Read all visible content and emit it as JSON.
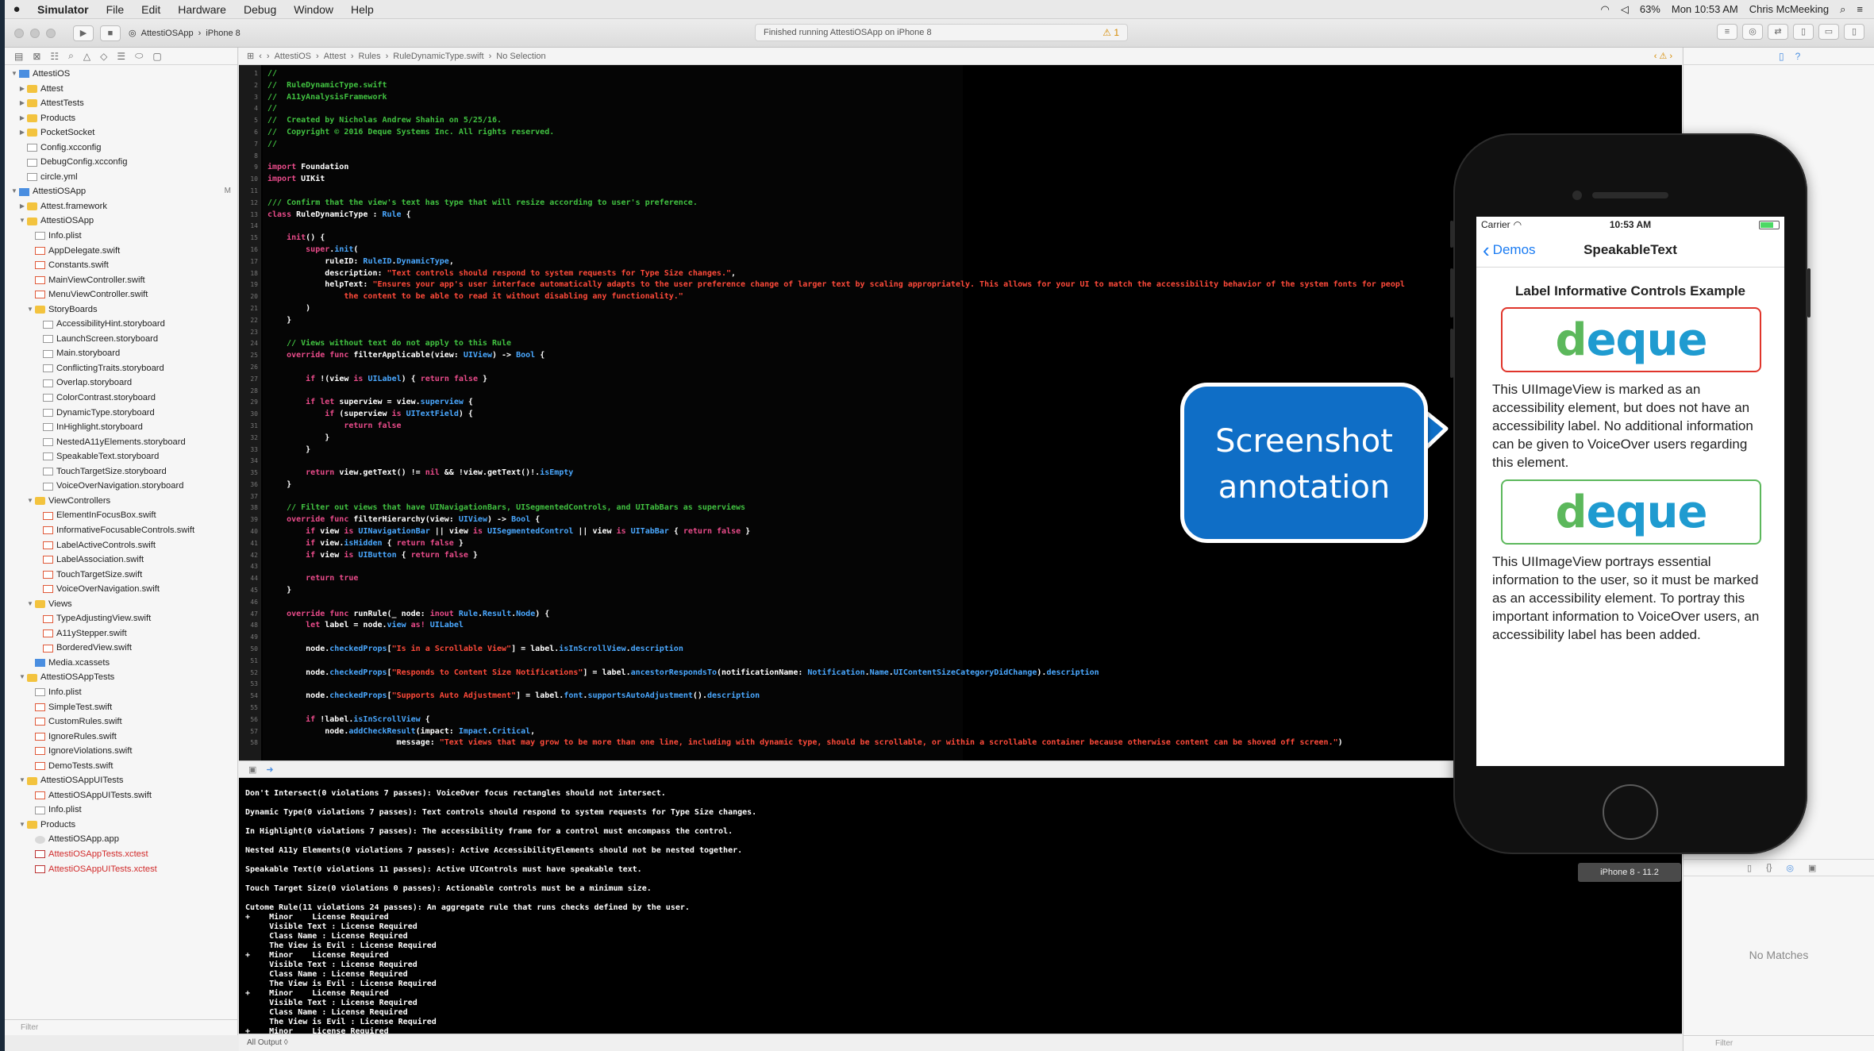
{
  "menubar": {
    "apple": "",
    "items": [
      "Simulator",
      "File",
      "Edit",
      "Hardware",
      "Debug",
      "Window",
      "Help"
    ],
    "battery": "63%",
    "clock": "Mon 10:53 AM",
    "user": "Chris McMeeking"
  },
  "toolbar": {
    "scheme": "AttestiOSApp",
    "device": "iPhone 8",
    "activity": "Finished running AttestiOSApp on iPhone 8",
    "warning_count": "1"
  },
  "jumpbar": [
    "AttestiOS",
    "Attest",
    "Rules",
    "RuleDynamicType.swift",
    "No Selection"
  ],
  "navigator": {
    "filter_placeholder": "Filter",
    "rows": [
      {
        "t": "AttestiOS",
        "d": 0,
        "tri": "▼",
        "i": "proj"
      },
      {
        "t": "Attest",
        "d": 1,
        "tri": "▶",
        "i": "folder"
      },
      {
        "t": "AttestTests",
        "d": 1,
        "tri": "▶",
        "i": "folder"
      },
      {
        "t": "Products",
        "d": 1,
        "tri": "▶",
        "i": "folder"
      },
      {
        "t": "PocketSocket",
        "d": 1,
        "tri": "▶",
        "i": "folder"
      },
      {
        "t": "Config.xcconfig",
        "d": 1,
        "tri": "",
        "i": "file"
      },
      {
        "t": "DebugConfig.xcconfig",
        "d": 1,
        "tri": "",
        "i": "file"
      },
      {
        "t": "circle.yml",
        "d": 1,
        "tri": "",
        "i": "file"
      },
      {
        "t": "AttestiOSApp",
        "d": 0,
        "tri": "▼",
        "i": "proj",
        "badge": "M"
      },
      {
        "t": "Attest.framework",
        "d": 1,
        "tri": "▶",
        "i": "folder"
      },
      {
        "t": "AttestiOSApp",
        "d": 1,
        "tri": "▼",
        "i": "folder"
      },
      {
        "t": "Info.plist",
        "d": 2,
        "tri": "",
        "i": "file"
      },
      {
        "t": "AppDelegate.swift",
        "d": 2,
        "tri": "",
        "i": "swift"
      },
      {
        "t": "Constants.swift",
        "d": 2,
        "tri": "",
        "i": "swift"
      },
      {
        "t": "MainViewController.swift",
        "d": 2,
        "tri": "",
        "i": "swift"
      },
      {
        "t": "MenuViewController.swift",
        "d": 2,
        "tri": "",
        "i": "swift"
      },
      {
        "t": "StoryBoards",
        "d": 2,
        "tri": "▼",
        "i": "folder"
      },
      {
        "t": "AccessibilityHint.storyboard",
        "d": 3,
        "tri": "",
        "i": "file"
      },
      {
        "t": "LaunchScreen.storyboard",
        "d": 3,
        "tri": "",
        "i": "file"
      },
      {
        "t": "Main.storyboard",
        "d": 3,
        "tri": "",
        "i": "file"
      },
      {
        "t": "ConflictingTraits.storyboard",
        "d": 3,
        "tri": "",
        "i": "file"
      },
      {
        "t": "Overlap.storyboard",
        "d": 3,
        "tri": "",
        "i": "file"
      },
      {
        "t": "ColorContrast.storyboard",
        "d": 3,
        "tri": "",
        "i": "file"
      },
      {
        "t": "DynamicType.storyboard",
        "d": 3,
        "tri": "",
        "i": "file"
      },
      {
        "t": "InHighlight.storyboard",
        "d": 3,
        "tri": "",
        "i": "file"
      },
      {
        "t": "NestedA11yElements.storyboard",
        "d": 3,
        "tri": "",
        "i": "file"
      },
      {
        "t": "SpeakableText.storyboard",
        "d": 3,
        "tri": "",
        "i": "file"
      },
      {
        "t": "TouchTargetSize.storyboard",
        "d": 3,
        "tri": "",
        "i": "file"
      },
      {
        "t": "VoiceOverNavigation.storyboard",
        "d": 3,
        "tri": "",
        "i": "file"
      },
      {
        "t": "ViewControllers",
        "d": 2,
        "tri": "▼",
        "i": "folder"
      },
      {
        "t": "ElementInFocusBox.swift",
        "d": 3,
        "tri": "",
        "i": "swift"
      },
      {
        "t": "InformativeFocusableControls.swift",
        "d": 3,
        "tri": "",
        "i": "swift"
      },
      {
        "t": "LabelActiveControls.swift",
        "d": 3,
        "tri": "",
        "i": "swift"
      },
      {
        "t": "LabelAssociation.swift",
        "d": 3,
        "tri": "",
        "i": "swift"
      },
      {
        "t": "TouchTargetSize.swift",
        "d": 3,
        "tri": "",
        "i": "swift"
      },
      {
        "t": "VoiceOverNavigation.swift",
        "d": 3,
        "tri": "",
        "i": "swift"
      },
      {
        "t": "Views",
        "d": 2,
        "tri": "▼",
        "i": "folder"
      },
      {
        "t": "TypeAdjustingView.swift",
        "d": 3,
        "tri": "",
        "i": "swift"
      },
      {
        "t": "A11yStepper.swift",
        "d": 3,
        "tri": "",
        "i": "swift"
      },
      {
        "t": "BorderedView.swift",
        "d": 3,
        "tri": "",
        "i": "swift"
      },
      {
        "t": "Media.xcassets",
        "d": 2,
        "tri": "",
        "i": "proj"
      },
      {
        "t": "AttestiOSAppTests",
        "d": 1,
        "tri": "▼",
        "i": "folder"
      },
      {
        "t": "Info.plist",
        "d": 2,
        "tri": "",
        "i": "file"
      },
      {
        "t": "SimpleTest.swift",
        "d": 2,
        "tri": "",
        "i": "swift"
      },
      {
        "t": "CustomRules.swift",
        "d": 2,
        "tri": "",
        "i": "swift"
      },
      {
        "t": "IgnoreRules.swift",
        "d": 2,
        "tri": "",
        "i": "swift"
      },
      {
        "t": "IgnoreViolations.swift",
        "d": 2,
        "tri": "",
        "i": "swift"
      },
      {
        "t": "DemoTests.swift",
        "d": 2,
        "tri": "",
        "i": "swift"
      },
      {
        "t": "AttestiOSAppUITests",
        "d": 1,
        "tri": "▼",
        "i": "folder"
      },
      {
        "t": "AttestiOSAppUITests.swift",
        "d": 2,
        "tri": "",
        "i": "swift"
      },
      {
        "t": "Info.plist",
        "d": 2,
        "tri": "",
        "i": "file"
      },
      {
        "t": "Products",
        "d": 1,
        "tri": "▼",
        "i": "folder"
      },
      {
        "t": "AttestiOSApp.app",
        "d": 2,
        "tri": "",
        "i": "app"
      },
      {
        "t": "AttestiOSAppTests.xctest",
        "d": 2,
        "tri": "",
        "i": "xc",
        "red": true
      },
      {
        "t": "AttestiOSAppUITests.xctest",
        "d": 2,
        "tri": "",
        "i": "xc",
        "red": true
      }
    ]
  },
  "code_lines": [
    [
      [
        "//",
        "com"
      ]
    ],
    [
      [
        "//  RuleDynamicType.swift",
        "com"
      ]
    ],
    [
      [
        "//  A11yAnalysisFramework",
        "com"
      ]
    ],
    [
      [
        "//",
        "com"
      ]
    ],
    [
      [
        "//  Created by Nicholas Andrew Shahin on 5/25/16.",
        "com"
      ]
    ],
    [
      [
        "//  Copyright © 2016 Deque Systems Inc. All rights reserved.",
        "com"
      ]
    ],
    [
      [
        "//",
        "com"
      ]
    ],
    [],
    [
      [
        "import",
        "kw"
      ],
      [
        " Foundation",
        ""
      ]
    ],
    [
      [
        "import",
        "kw"
      ],
      [
        " UIKit",
        ""
      ]
    ],
    [],
    [
      [
        "/// Confirm that the view's text has type that will resize according to user's preference.",
        "com"
      ]
    ],
    [
      [
        "class",
        "kw"
      ],
      [
        " RuleDynamicType : ",
        ""
      ],
      [
        "Rule",
        "ty"
      ],
      [
        " {",
        ""
      ]
    ],
    [],
    [
      [
        "    init",
        "kw"
      ],
      [
        "() {",
        ""
      ]
    ],
    [
      [
        "        super",
        "kw"
      ],
      [
        ".",
        ""
      ],
      [
        "init",
        "fn"
      ],
      [
        "(",
        ""
      ]
    ],
    [
      [
        "            ruleID: ",
        ""
      ],
      [
        "RuleID",
        "ty"
      ],
      [
        ".",
        ""
      ],
      [
        "DynamicType",
        "ty"
      ],
      [
        ",",
        ""
      ]
    ],
    [
      [
        "            description: ",
        ""
      ],
      [
        "\"Text controls should respond to system requests for Type Size changes.\"",
        "str"
      ],
      [
        ",",
        ""
      ]
    ],
    [
      [
        "            helpText: ",
        ""
      ],
      [
        "\"Ensures your app's user interface automatically adapts to the user preference change of larger text by scaling appropriately. This allows for your UI to match the accessibility behavior of the system fonts for peopl",
        "str"
      ]
    ],
    [
      [
        "                the content to be able to read it without disabling any functionality.\"",
        "str"
      ]
    ],
    [
      [
        "        )",
        ""
      ]
    ],
    [
      [
        "    }",
        ""
      ]
    ],
    [],
    [
      [
        "    // Views without text do not apply to this Rule",
        "com"
      ]
    ],
    [
      [
        "    override func",
        "kw"
      ],
      [
        " filterApplicable(view: ",
        ""
      ],
      [
        "UIView",
        "ty"
      ],
      [
        ") -> ",
        ""
      ],
      [
        "Bool",
        "ty"
      ],
      [
        " {",
        ""
      ]
    ],
    [],
    [
      [
        "        if",
        "kw"
      ],
      [
        " !(view ",
        ""
      ],
      [
        "is",
        "kw"
      ],
      [
        " ",
        ""
      ],
      [
        "UILabel",
        "ty"
      ],
      [
        ") { ",
        ""
      ],
      [
        "return false",
        "kw"
      ],
      [
        " }",
        ""
      ]
    ],
    [],
    [
      [
        "        if let",
        "kw"
      ],
      [
        " superview = view.",
        ""
      ],
      [
        "superview",
        "fn"
      ],
      [
        " {",
        ""
      ]
    ],
    [
      [
        "            if",
        "kw"
      ],
      [
        " (superview ",
        ""
      ],
      [
        "is",
        "kw"
      ],
      [
        " ",
        ""
      ],
      [
        "UITextField",
        "ty"
      ],
      [
        ") {",
        ""
      ]
    ],
    [
      [
        "                return false",
        "kw"
      ]
    ],
    [
      [
        "            }",
        ""
      ]
    ],
    [
      [
        "        }",
        ""
      ]
    ],
    [],
    [
      [
        "        return",
        "kw"
      ],
      [
        " view.getText() != ",
        ""
      ],
      [
        "nil",
        "kw"
      ],
      [
        " && !view.getText()!.",
        ""
      ],
      [
        "isEmpty",
        "fn"
      ]
    ],
    [
      [
        "    }",
        ""
      ]
    ],
    [],
    [
      [
        "    // Filter out views that have UINavigationBars, UISegmentedControls, and UITabBars as superviews",
        "com"
      ]
    ],
    [
      [
        "    override func",
        "kw"
      ],
      [
        " filterHierarchy(view: ",
        ""
      ],
      [
        "UIView",
        "ty"
      ],
      [
        ") -> ",
        ""
      ],
      [
        "Bool",
        "ty"
      ],
      [
        " {",
        ""
      ]
    ],
    [
      [
        "        if",
        "kw"
      ],
      [
        " view ",
        ""
      ],
      [
        "is",
        "kw"
      ],
      [
        " ",
        ""
      ],
      [
        "UINavigationBar",
        "ty"
      ],
      [
        " || view ",
        ""
      ],
      [
        "is",
        "kw"
      ],
      [
        " ",
        ""
      ],
      [
        "UISegmentedControl",
        "ty"
      ],
      [
        " || view ",
        ""
      ],
      [
        "is",
        "kw"
      ],
      [
        " ",
        ""
      ],
      [
        "UITabBar",
        "ty"
      ],
      [
        " { ",
        ""
      ],
      [
        "return false",
        "kw"
      ],
      [
        " }",
        ""
      ]
    ],
    [
      [
        "        if",
        "kw"
      ],
      [
        " view.",
        ""
      ],
      [
        "isHidden",
        "fn"
      ],
      [
        " { ",
        ""
      ],
      [
        "return false",
        "kw"
      ],
      [
        " }",
        ""
      ]
    ],
    [
      [
        "        if",
        "kw"
      ],
      [
        " view ",
        ""
      ],
      [
        "is",
        "kw"
      ],
      [
        " ",
        ""
      ],
      [
        "UIButton",
        "ty"
      ],
      [
        " { ",
        ""
      ],
      [
        "return false",
        "kw"
      ],
      [
        " }",
        ""
      ]
    ],
    [],
    [
      [
        "        return true",
        "kw"
      ]
    ],
    [
      [
        "    }",
        ""
      ]
    ],
    [],
    [
      [
        "    override func",
        "kw"
      ],
      [
        " runRule(_ node: ",
        ""
      ],
      [
        "inout",
        "kw"
      ],
      [
        " ",
        ""
      ],
      [
        "Rule",
        "ty"
      ],
      [
        ".",
        ""
      ],
      [
        "Result",
        "ty"
      ],
      [
        ".",
        ""
      ],
      [
        "Node",
        "ty"
      ],
      [
        ") {",
        ""
      ]
    ],
    [
      [
        "        let",
        "kw"
      ],
      [
        " label = node.",
        ""
      ],
      [
        "view",
        "fn"
      ],
      [
        " ",
        ""
      ],
      [
        "as!",
        "kw"
      ],
      [
        " ",
        ""
      ],
      [
        "UILabel",
        "ty"
      ]
    ],
    [],
    [
      [
        "        node.",
        ""
      ],
      [
        "checkedProps",
        "fn"
      ],
      [
        "[",
        ""
      ],
      [
        "\"Is in a Scrollable View\"",
        "str"
      ],
      [
        "] = label.",
        ""
      ],
      [
        "isInScrollView",
        "fn"
      ],
      [
        ".",
        ""
      ],
      [
        "description",
        "fn"
      ]
    ],
    [],
    [
      [
        "        node.",
        ""
      ],
      [
        "checkedProps",
        "fn"
      ],
      [
        "[",
        ""
      ],
      [
        "\"Responds to Content Size Notifications\"",
        "str"
      ],
      [
        "] = label.",
        ""
      ],
      [
        "ancestorRespondsTo",
        "fn"
      ],
      [
        "(notificationName: ",
        ""
      ],
      [
        "Notification",
        "ty"
      ],
      [
        ".",
        ""
      ],
      [
        "Name",
        "ty"
      ],
      [
        ".",
        ""
      ],
      [
        "UIContentSizeCategoryDidChange",
        "ty"
      ],
      [
        ").",
        ""
      ],
      [
        "description",
        "fn"
      ]
    ],
    [],
    [
      [
        "        node.",
        ""
      ],
      [
        "checkedProps",
        "fn"
      ],
      [
        "[",
        ""
      ],
      [
        "\"Supports Auto Adjustment\"",
        "str"
      ],
      [
        "] = label.",
        ""
      ],
      [
        "font",
        "fn"
      ],
      [
        ".",
        ""
      ],
      [
        "supportsAutoAdjustment",
        "fn"
      ],
      [
        "().",
        ""
      ],
      [
        "description",
        "fn"
      ]
    ],
    [],
    [
      [
        "        if",
        "kw"
      ],
      [
        " !label.",
        ""
      ],
      [
        "isInScrollView",
        "fn"
      ],
      [
        " {",
        ""
      ]
    ],
    [
      [
        "            node.",
        ""
      ],
      [
        "addCheckResult",
        "fn"
      ],
      [
        "(impact: ",
        ""
      ],
      [
        "Impact",
        "ty"
      ],
      [
        ".",
        ""
      ],
      [
        "Critical",
        "ty"
      ],
      [
        ",",
        ""
      ]
    ],
    [
      [
        "                           message: ",
        ""
      ],
      [
        "\"Text views that may grow to be more than one line, including with dynamic type, should be scrollable, or within a scrollable container because otherwise content can be shoved off screen.\"",
        "str"
      ],
      [
        ")",
        ""
      ]
    ]
  ],
  "console": {
    "lines": [
      "Don't Intersect(0 violations 7 passes): VoiceOver focus rectangles should not intersect.",
      "Dynamic Type(0 violations 7 passes): Text controls should respond to system requests for Type Size changes.",
      "In Highlight(0 violations 7 passes): The accessibility frame for a control must encompass the control.",
      "Nested A11y Elements(0 violations 7 passes): Active AccessibilityElements should not be nested together.",
      "Speakable Text(0 violations 11 passes): Active UIControls must have speakable text.",
      "Touch Target Size(0 violations 0 passes): Actionable controls must be a minimum size."
    ],
    "custom_lines": [
      "Cutome Rule(11 violations 24 passes): An aggregate rule that runs checks defined by the user.",
      "+    Minor    License Required",
      "     Visible Text : License Required",
      "     Class Name : License Required",
      "     The View is Evil : License Required",
      "+    Minor    License Required",
      "     Visible Text : License Required",
      "     Class Name : License Required",
      "     The View is Evil : License Required",
      "+    Minor    License Required",
      "     Visible Text : License Required",
      "     Class Name : License Required",
      "     The View is Evil : License Required",
      "+    Minor    License Required"
    ],
    "output_label": "All Output ◊"
  },
  "simulator": {
    "carrier": "Carrier",
    "time": "10:53 AM",
    "back_label": "Demos",
    "nav_title": "SpeakableText",
    "heading": "Label Informative Controls Example",
    "logo_prefix": "d",
    "logo_rest": "eque",
    "para1": "This UIImageView is marked as an accessibility element, but does not have an accessibility label.  No additional information can be given to VoiceOver users regarding this element.",
    "para2": "This UIImageView portrays essential information to the user, so it must be marked as an accessibility element.  To portray this important information to VoiceOver users, an accessibility label has been added.",
    "device_label": "iPhone 8 - 11.2"
  },
  "callout": {
    "line1": "Screenshot",
    "line2": "annotation"
  },
  "inspector": {
    "no_matches": "No Matches",
    "filter_placeholder": "Filter"
  },
  "colors": {
    "accent": "#0f6ec6",
    "comment": "#41c241",
    "keyword": "#e94b8a",
    "string": "#ff4a3a",
    "type": "#4aa8ff"
  }
}
